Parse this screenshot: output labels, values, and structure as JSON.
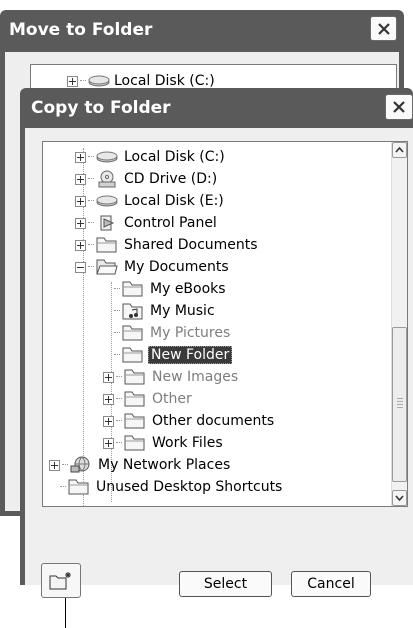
{
  "back_dialog": {
    "title": "Move to Folder",
    "visible_item": "Local Disk (C:)"
  },
  "front_dialog": {
    "title": "Copy to Folder",
    "tree": [
      {
        "label": "Local Disk (C:)",
        "icon": "hard-drive-icon",
        "expander": "plus",
        "indent": 0
      },
      {
        "label": "CD Drive (D:)",
        "icon": "cd-drive-icon",
        "expander": "plus",
        "indent": 0
      },
      {
        "label": "Local Disk (E:)",
        "icon": "hard-drive-icon",
        "expander": "plus",
        "indent": 0
      },
      {
        "label": "Control Panel",
        "icon": "control-panel-icon",
        "expander": "plus",
        "indent": 0
      },
      {
        "label": "Shared Documents",
        "icon": "folder-icon",
        "expander": "plus",
        "indent": 0
      },
      {
        "label": "My Documents",
        "icon": "folder-open-icon",
        "expander": "minus",
        "indent": 0
      },
      {
        "label": "My eBooks",
        "icon": "folder-icon",
        "expander": "none",
        "indent": 1
      },
      {
        "label": "My Music",
        "icon": "music-folder-icon",
        "expander": "none",
        "indent": 1
      },
      {
        "label": "My Pictures",
        "icon": "folder-icon",
        "expander": "none",
        "indent": 1,
        "dim": true
      },
      {
        "label": "New Folder",
        "icon": "folder-icon",
        "expander": "none",
        "indent": 1,
        "selected": true
      },
      {
        "label": "New Images",
        "icon": "folder-icon",
        "expander": "plus",
        "indent": 1,
        "dim": true
      },
      {
        "label": "Other",
        "icon": "folder-icon",
        "expander": "plus",
        "indent": 1,
        "dim": true
      },
      {
        "label": "Other documents",
        "icon": "folder-icon",
        "expander": "plus",
        "indent": 1
      },
      {
        "label": "Work Files",
        "icon": "folder-icon",
        "expander": "plus",
        "indent": 1
      },
      {
        "label": "My Network Places",
        "icon": "network-places-icon",
        "expander": "plus",
        "indent": -1
      },
      {
        "label": "Unused Desktop Shortcuts",
        "icon": "folder-icon",
        "expander": "none",
        "indent": -1
      }
    ],
    "buttons": {
      "select": "Select",
      "cancel": "Cancel"
    },
    "new_folder_icon": "new-folder-icon"
  },
  "colors": {
    "title_bar": "#5a5a5a",
    "dialog_bg": "#efefef",
    "selection": "#3a3a3a"
  }
}
